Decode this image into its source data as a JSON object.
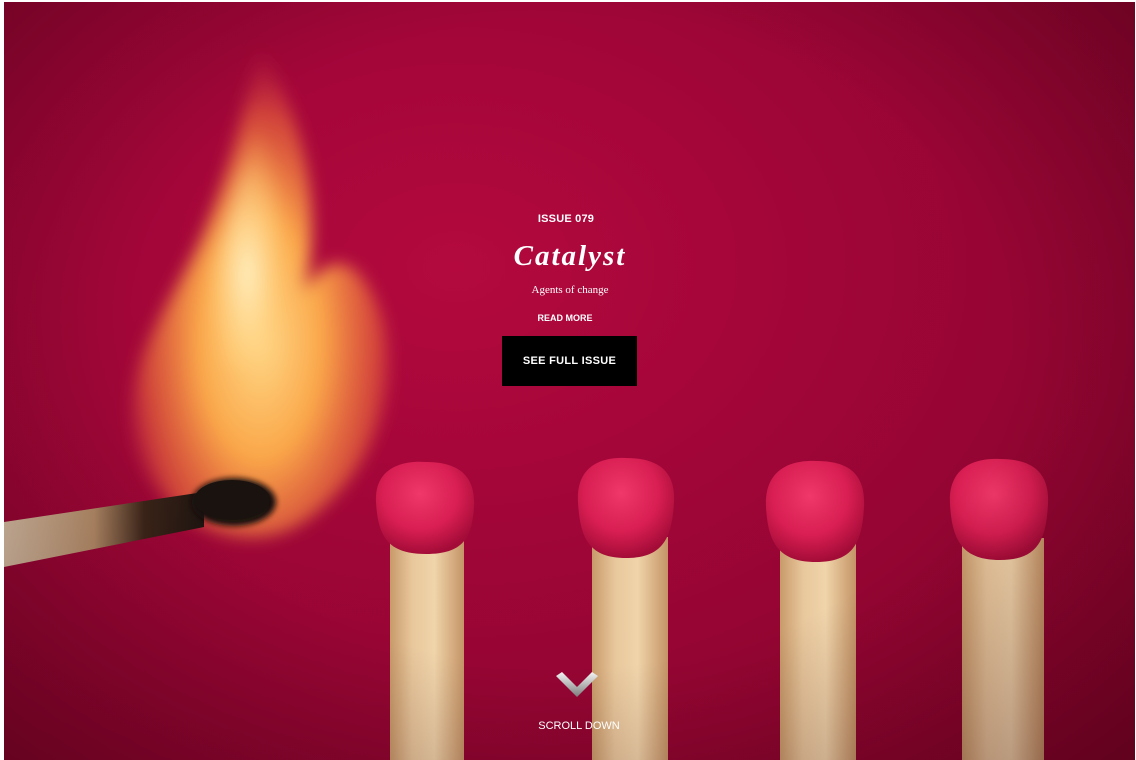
{
  "hero": {
    "issue_label": "ISSUE 079",
    "title": "Catalyst",
    "subtitle": "Agents of change",
    "read_more_label": "READ MORE",
    "full_issue_label": "SEE FULL ISSUE",
    "scroll_label": "SCROLL DOWN",
    "image_description_icon": "chevron-down-icon"
  },
  "colors": {
    "background": "#a5063a",
    "button_bg": "#000000",
    "text": "#ffffff"
  }
}
